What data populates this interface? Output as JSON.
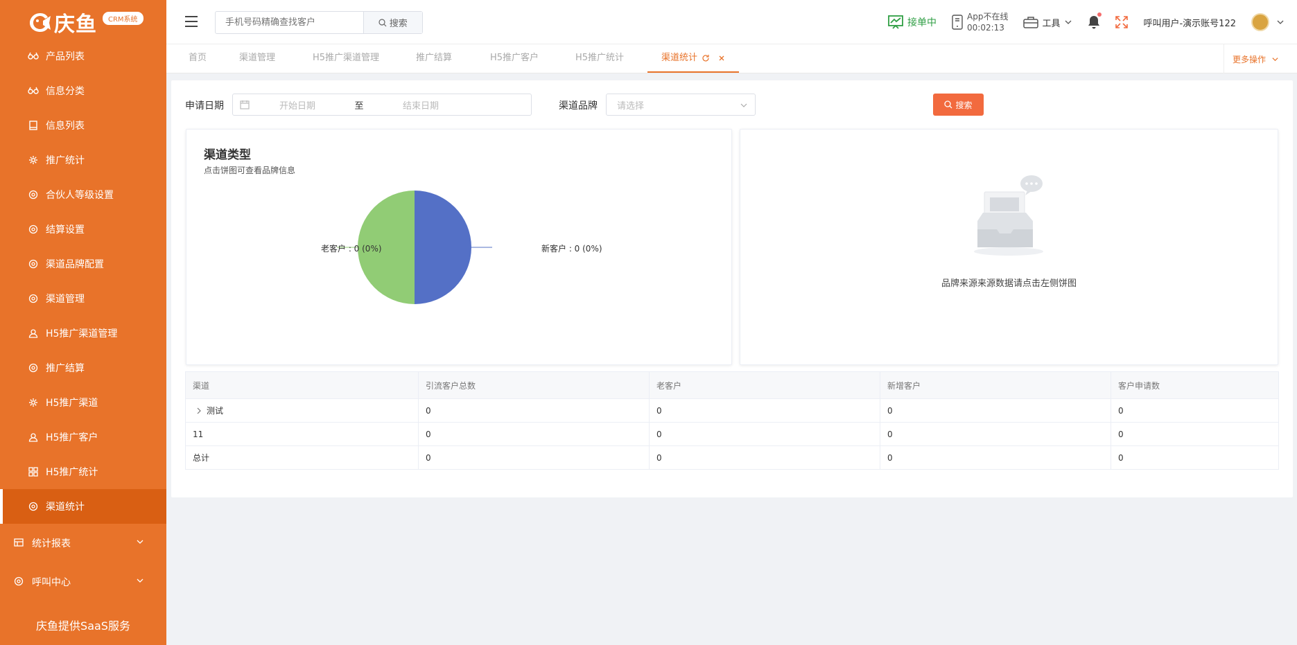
{
  "logo": {
    "text": "庆鱼",
    "badge": "CRM系统"
  },
  "sidebar": {
    "items": [
      {
        "label": "产品列表",
        "icon": "glasses-icon"
      },
      {
        "label": "信息分类",
        "icon": "glasses-icon"
      },
      {
        "label": "信息列表",
        "icon": "book-icon"
      },
      {
        "label": "推广统计",
        "icon": "gear-icon"
      },
      {
        "label": "合伙人等级设置",
        "icon": "gear-icon"
      },
      {
        "label": "结算设置",
        "icon": "gear-icon"
      },
      {
        "label": "渠道品牌配置",
        "icon": "gear-icon"
      },
      {
        "label": "渠道管理",
        "icon": "gear-icon"
      },
      {
        "label": "H5推广渠道管理",
        "icon": "user-icon"
      },
      {
        "label": "推广结算",
        "icon": "gear-icon"
      },
      {
        "label": "H5推广渠道",
        "icon": "gear-icon"
      },
      {
        "label": "H5推广客户",
        "icon": "user-icon"
      },
      {
        "label": "H5推广统计",
        "icon": "grid-icon"
      },
      {
        "label": "渠道统计",
        "icon": "gear-icon",
        "active": true
      }
    ],
    "groups": [
      {
        "label": "统计报表",
        "icon": "table-icon"
      },
      {
        "label": "呼叫中心",
        "icon": "gear-icon"
      }
    ],
    "footer": "庆鱼提供SaaS服务"
  },
  "header": {
    "search_placeholder": "手机号码精确查找客户",
    "search_button": "搜索",
    "order_status": "接单中",
    "app_status": "App不在线",
    "app_timer": "00:02:13",
    "tools": "工具",
    "user": "呼叫用户-演示账号122"
  },
  "tabs": [
    {
      "label": "首页"
    },
    {
      "label": "渠道管理"
    },
    {
      "label": "H5推广渠道管理"
    },
    {
      "label": "推广结算"
    },
    {
      "label": "H5推广客户"
    },
    {
      "label": "H5推广统计"
    },
    {
      "label": "渠道统计",
      "active": true
    }
  ],
  "more_ops": "更多操作",
  "filters": {
    "date_label": "申请日期",
    "start_placeholder": "开始日期",
    "range_sep": "至",
    "end_placeholder": "结束日期",
    "brand_label": "渠道品牌",
    "brand_placeholder": "请选择",
    "search_button": "搜索"
  },
  "left_panel": {
    "title": "渠道类型",
    "subtitle": "点击饼图可查看品牌信息"
  },
  "chart_data": {
    "type": "pie",
    "slices": [
      {
        "name": "新客户",
        "value": 0,
        "label": "新客户 : 0 (0%)",
        "color": "#5470c6"
      },
      {
        "name": "老客户",
        "value": 0,
        "label": "老客户 : 0 (0%)",
        "color": "#91cc75"
      }
    ]
  },
  "right_panel": {
    "empty_message": "品牌来源来源数据请点击左侧饼图"
  },
  "table": {
    "columns": [
      "渠道",
      "引流客户总数",
      "老客户",
      "新增客户",
      "客户申请数"
    ],
    "rows": [
      [
        "测试",
        "0",
        "0",
        "0",
        "0"
      ],
      [
        "11",
        "0",
        "0",
        "0",
        "0"
      ],
      [
        "总计",
        "0",
        "0",
        "0",
        "0"
      ]
    ]
  },
  "colors": {
    "brand": "#e8732a",
    "sidebar_active": "#d95f13",
    "search_button": "#f26a3e",
    "order_status": "#2f9e44"
  }
}
